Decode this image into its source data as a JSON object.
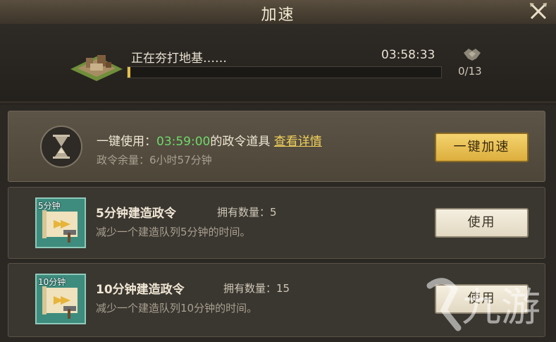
{
  "header": {
    "title": "加速",
    "close_icon": "close-crossed-swords-icon"
  },
  "progress": {
    "status_text": "正在夯打地基……",
    "timer": "03:58:33",
    "percent": 1,
    "help_icon": "handshake-icon",
    "help_count": "0/13"
  },
  "speedup_card": {
    "icon": "hourglass-icon",
    "use_prefix": "一键使用：",
    "duration": "03:59:00",
    "use_suffix": "的政令道具",
    "details_link": "查看详情",
    "remaining": "政令余量：6小时57分钟",
    "button_label": "一键加速"
  },
  "items": [
    {
      "badge": "5分钟",
      "title": "5分钟建造政令",
      "owned": "拥有数量：5",
      "desc": "减少一个建造队列5分钟的时间。",
      "button_label": "使用"
    },
    {
      "badge": "10分钟",
      "title": "10分钟建造政令",
      "owned": "拥有数量：15",
      "desc": "减少一个建造队列10分钟的时间。",
      "button_label": "使用"
    }
  ],
  "watermark": "九游",
  "colors": {
    "accent_gold": "#e3c04b",
    "time_green": "#6fd96a",
    "link_yellow": "#f1d15b",
    "item_teal": "#3d8c7e"
  }
}
